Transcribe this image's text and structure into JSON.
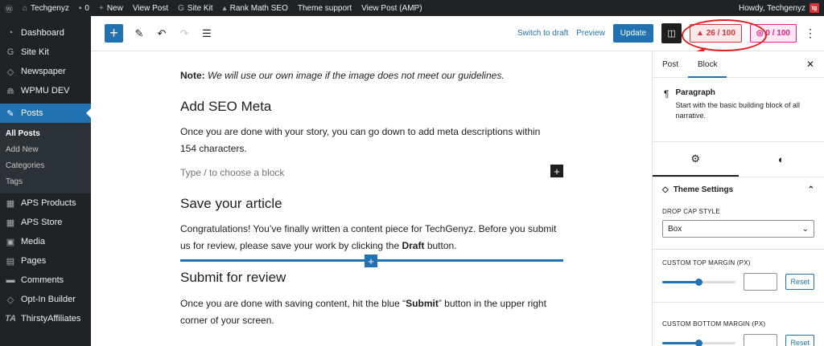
{
  "admin_bar": {
    "site_name": "Techgenyz",
    "comments_count": "0",
    "new_label": "New",
    "view_post": "View Post",
    "site_kit": "Site Kit",
    "rank_math": "Rank Math SEO",
    "theme_support": "Theme support",
    "view_post_amp": "View Post (AMP)",
    "howdy": "Howdy, Techgenyz",
    "avatar_text": "tg"
  },
  "sidebar": {
    "items": [
      {
        "label": "Dashboard",
        "icon": "dashboard-icon"
      },
      {
        "label": "Site Kit",
        "icon": "google-icon"
      },
      {
        "label": "Newspaper",
        "icon": "newspaper-icon"
      },
      {
        "label": "WPMU DEV",
        "icon": "wpmudev-icon"
      },
      {
        "label": "Posts",
        "icon": "pin-icon"
      },
      {
        "label": "APS Products",
        "icon": "products-icon"
      },
      {
        "label": "APS Store",
        "icon": "store-icon"
      },
      {
        "label": "Media",
        "icon": "media-icon"
      },
      {
        "label": "Pages",
        "icon": "pages-icon"
      },
      {
        "label": "Comments",
        "icon": "comments-icon"
      },
      {
        "label": "Opt-In Builder",
        "icon": "optin-icon"
      },
      {
        "label": "ThirstyAffiliates",
        "icon": "ta-icon"
      }
    ],
    "posts_sub": [
      "All Posts",
      "Add New",
      "Categories",
      "Tags"
    ]
  },
  "toolbar": {
    "switch_to_draft": "Switch to draft",
    "preview": "Preview",
    "update": "Update",
    "seo_score": "26 / 100",
    "readability_score": "0 / 100",
    "accent": "#2271b1",
    "score_color": "#d63638"
  },
  "content": {
    "note_label": "Note:",
    "note_text": " We will use our own image if the image does not meet our guidelines.",
    "heading1": "Add SEO Meta",
    "para1": "Once you are done with your story, you can go down to add meta descriptions within 154 characters.",
    "placeholder": "Type / to choose a block",
    "heading2": "Save your article",
    "para2_a": "Congratulations! You’ve finally written a content piece for TechGenyz. Before you submit us for review, please save your work by clicking the ",
    "para2_bold": "Draft",
    "para2_b": " button.",
    "heading3": "Submit for review",
    "para3_a": "Once you are done with saving content, hit the blue “",
    "para3_bold": "Submit",
    "para3_b": "” button in the upper right corner of your screen."
  },
  "panel": {
    "tab_post": "Post",
    "tab_block": "Block",
    "block_title": "Paragraph",
    "block_desc": "Start with the basic building block of all narrative.",
    "theme_settings": "Theme Settings",
    "drop_cap_label": "DROP CAP STYLE",
    "drop_cap_value": "Box",
    "top_margin_label": "CUSTOM TOP MARGIN (PX)",
    "top_margin_level": 0.5,
    "bottom_margin_label": "CUSTOM BOTTOM MARGIN (PX)",
    "bottom_margin_level": 0.5,
    "reset_label": "Reset"
  }
}
